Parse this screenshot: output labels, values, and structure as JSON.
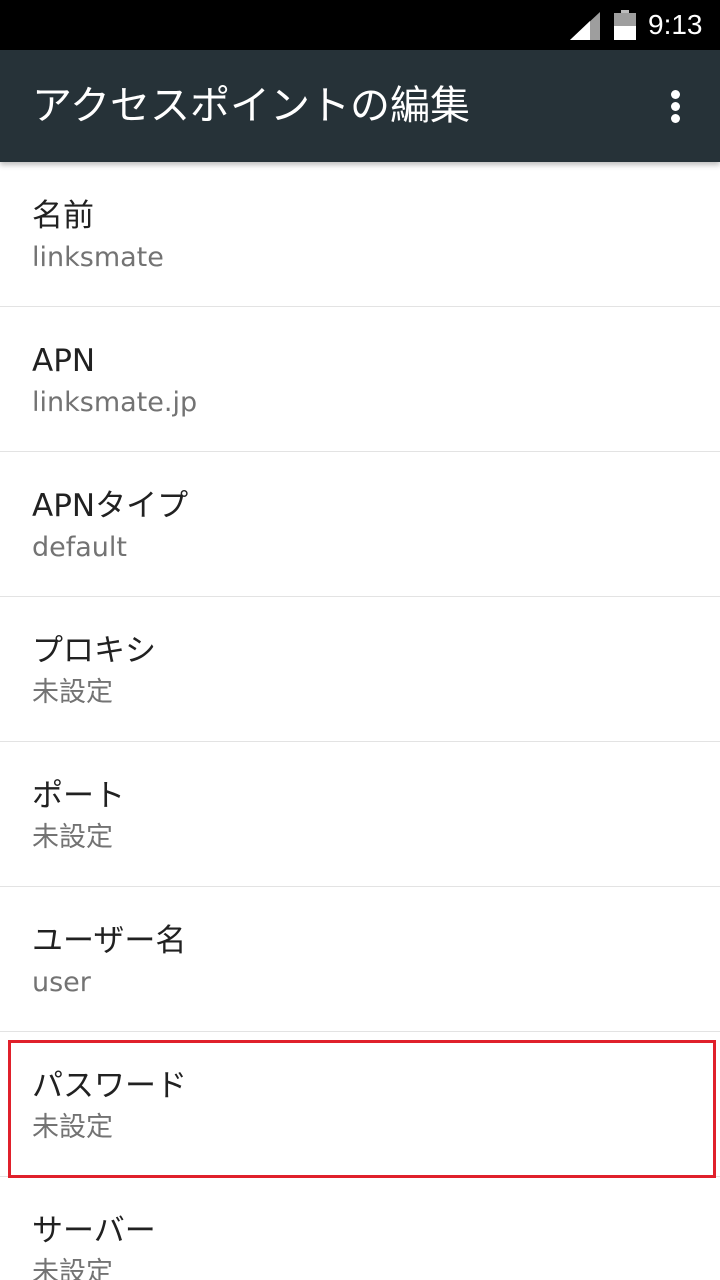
{
  "status_bar": {
    "time": "9:13",
    "signal_icon": "cell-signal-icon",
    "battery_icon": "battery-icon"
  },
  "toolbar": {
    "title": "アクセスポイントの編集",
    "overflow_icon": "more-vert-icon",
    "background": "#263238"
  },
  "preferences": [
    {
      "key": "name",
      "title": "名前",
      "summary": "linksmate"
    },
    {
      "key": "apn",
      "title": "APN",
      "summary": "linksmate.jp"
    },
    {
      "key": "apn-type",
      "title": "APNタイプ",
      "summary": "default"
    },
    {
      "key": "proxy",
      "title": "プロキシ",
      "summary": "未設定"
    },
    {
      "key": "port",
      "title": "ポート",
      "summary": "未設定"
    },
    {
      "key": "username",
      "title": "ユーザー名",
      "summary": "user"
    },
    {
      "key": "password",
      "title": "パスワード",
      "summary": "未設定"
    },
    {
      "key": "server",
      "title": "サーバー",
      "summary": "未設定"
    }
  ],
  "highlight": {
    "target": "password",
    "color": "#e0202b"
  }
}
